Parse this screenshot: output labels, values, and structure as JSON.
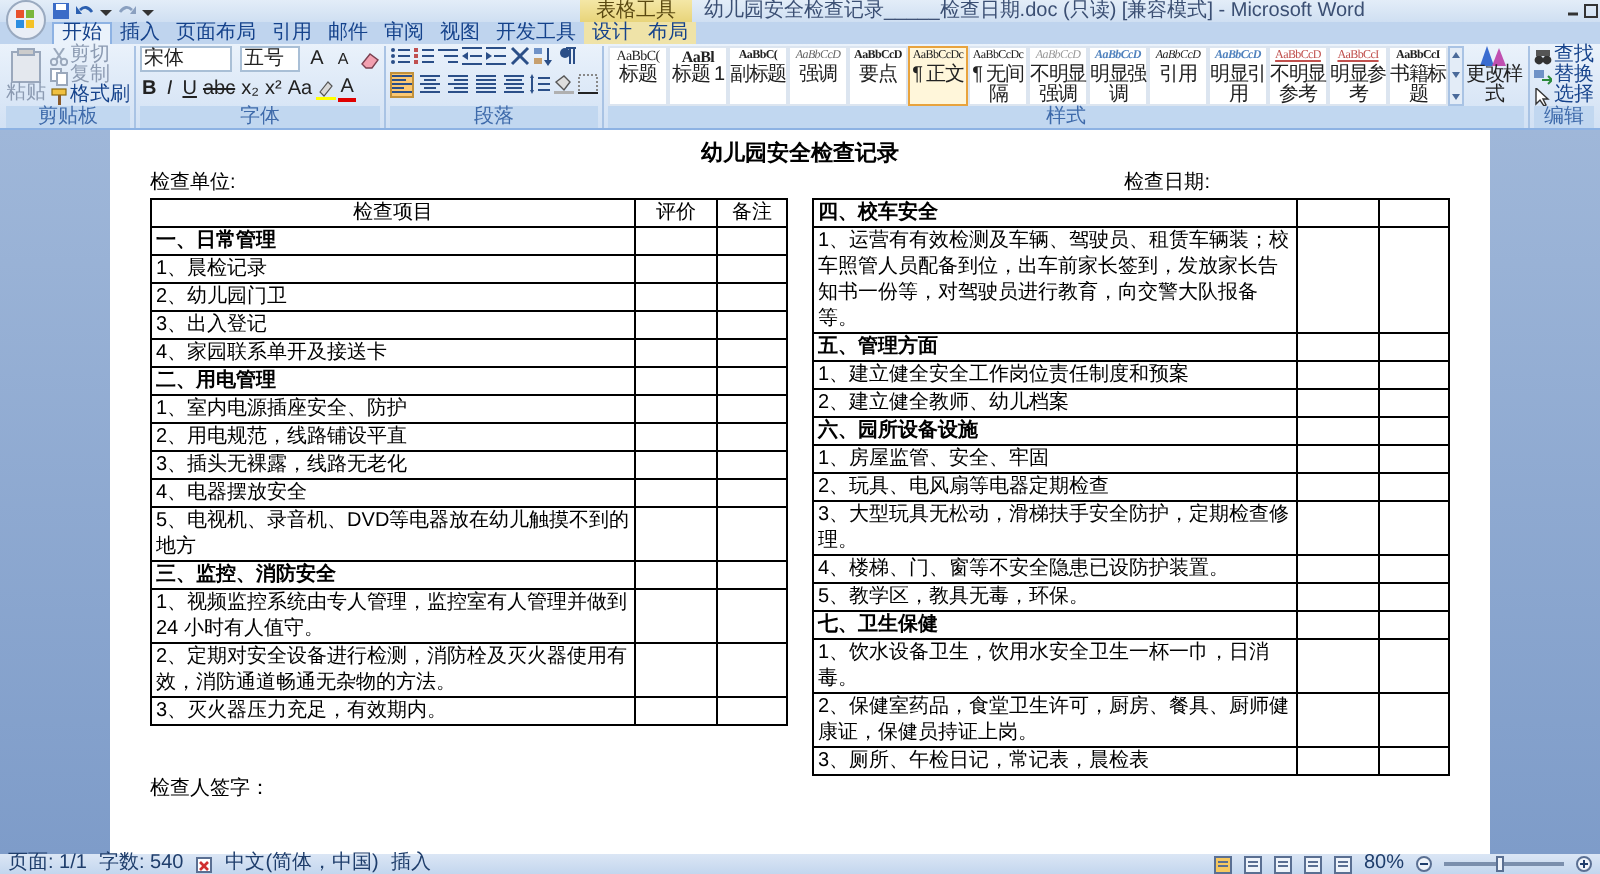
{
  "title_bar": {
    "contextual_tab": "表格工具",
    "title": "幼儿园安全检查记录_____检查日期.doc (只读) [兼容模式] - Microsoft Word"
  },
  "tabs": [
    {
      "label": "开始",
      "selected": true,
      "contextual": false
    },
    {
      "label": "插入",
      "selected": false,
      "contextual": false
    },
    {
      "label": "页面布局",
      "selected": false,
      "contextual": false
    },
    {
      "label": "引用",
      "selected": false,
      "contextual": false
    },
    {
      "label": "邮件",
      "selected": false,
      "contextual": false
    },
    {
      "label": "审阅",
      "selected": false,
      "contextual": false
    },
    {
      "label": "视图",
      "selected": false,
      "contextual": false
    },
    {
      "label": "开发工具",
      "selected": false,
      "contextual": false
    },
    {
      "label": "设计",
      "selected": false,
      "contextual": true
    },
    {
      "label": "布局",
      "selected": false,
      "contextual": true
    }
  ],
  "ribbon": {
    "clipboard": {
      "label": "剪贴板",
      "paste": {
        "label": "粘贴",
        "disabled": true
      },
      "items": [
        {
          "label": "剪切",
          "kind": "cut",
          "disabled": true
        },
        {
          "label": "复制",
          "kind": "copy",
          "disabled": true
        },
        {
          "label": "格式刷",
          "kind": "brush",
          "disabled": false
        }
      ]
    },
    "font": {
      "label": "字体",
      "font_name": "宋体",
      "font_size": "五号",
      "top_buttons": [
        {
          "label": "A",
          "kind": "grow"
        },
        {
          "label": "A",
          "kind": "shrink"
        }
      ],
      "bottom_buttons": [
        {
          "label": "B",
          "kind": "bold"
        },
        {
          "label": "I",
          "kind": "italic"
        },
        {
          "label": "U",
          "kind": "underline"
        },
        {
          "label": "abc",
          "kind": "strike"
        },
        {
          "label": "x₂",
          "kind": "plain"
        },
        {
          "label": "x²",
          "kind": "plain"
        },
        {
          "label": "Aa",
          "kind": "plain"
        },
        {
          "label": "A",
          "kind": "color"
        }
      ]
    },
    "paragraph": {
      "label": "段落",
      "alignment": [
        {
          "selected": true
        },
        {
          "selected": false
        },
        {
          "selected": false
        },
        {
          "selected": false
        },
        {
          "selected": false
        }
      ]
    },
    "styles": {
      "label": "样式",
      "change_styles": "更改样式",
      "items": [
        {
          "preview": "AaBbC(",
          "name": "标题",
          "kind": "title",
          "selected": false
        },
        {
          "preview": "AaBl",
          "name": "标题 1",
          "kind": "heading",
          "selected": false
        },
        {
          "preview": "AaBbC(",
          "name": "副标题",
          "kind": "subtitle",
          "selected": false
        },
        {
          "preview": "AaBbCcD",
          "name": "强调",
          "kind": "emphasis",
          "selected": false
        },
        {
          "preview": "AaBbCcD",
          "name": "要点",
          "kind": "strong",
          "selected": false
        },
        {
          "preview": "AaBbCcDc",
          "name": "¶ 正文",
          "kind": "normal",
          "selected": true
        },
        {
          "preview": "AaBbCcDc",
          "name": "¶ 无间隔",
          "kind": "normal",
          "selected": false
        },
        {
          "preview": "AaBbCcD",
          "name": "不明显强调",
          "kind": "subtle",
          "selected": false
        },
        {
          "preview": "AaBbCcD",
          "name": "明显强调",
          "kind": "intense",
          "selected": false
        },
        {
          "preview": "AaBbCcD",
          "name": "引用",
          "kind": "quote",
          "selected": false
        },
        {
          "preview": "AaBbCcD",
          "name": "明显引用",
          "kind": "intense",
          "selected": false
        },
        {
          "preview": "AaBbCcD",
          "name": "不明显参考",
          "kind": "reference",
          "selected": false
        },
        {
          "preview": "AaBbCcI",
          "name": "明显参考",
          "kind": "reference",
          "selected": false
        },
        {
          "preview": "AaBbCcI",
          "name": "书籍标题",
          "kind": "strong",
          "selected": false
        }
      ]
    },
    "editing": {
      "label": "编辑",
      "items": [
        {
          "label": "查找",
          "kind": "find"
        },
        {
          "label": "替换",
          "kind": "replace"
        },
        {
          "label": "选择",
          "kind": "select"
        }
      ]
    }
  },
  "document": {
    "title": "幼儿园安全检查记录",
    "unit_label": "检查单位:",
    "date_label": "检查日期:",
    "columns": [
      "检查项目",
      "评价",
      "备注"
    ],
    "rows": [
      {
        "text": "一、日常管理",
        "kind": "section"
      },
      {
        "text": "1、晨检记录",
        "kind": "item"
      },
      {
        "text": "2、幼儿园门卫",
        "kind": "item"
      },
      {
        "text": "3、出入登记",
        "kind": "item"
      },
      {
        "text": "4、家园联系单开及接送卡",
        "kind": "item"
      },
      {
        "text": "二、用电管理",
        "kind": "section"
      },
      {
        "text": "1、室内电源插座安全、防护",
        "kind": "item"
      },
      {
        "text": "2、用电规范，线路铺设平直",
        "kind": "item"
      },
      {
        "text": "3、插头无裸露，线路无老化",
        "kind": "item"
      },
      {
        "text": "4、电器摆放安全",
        "kind": "item"
      },
      {
        "text": "5、电视机、录音机、DVD等电器放在幼儿触摸不到的地方",
        "kind": "item"
      },
      {
        "text": "三、监控、消防安全",
        "kind": "section"
      },
      {
        "text": "1、视频监控系统由专人管理，监控室有人管理并做到 24 小时有人值守。",
        "kind": "item"
      },
      {
        "text": "2、定期对安全设备进行检测，消防栓及灭火器使用有效，消防通道畅通无杂物的方法。",
        "kind": "item"
      },
      {
        "text": "3、灭火器压力充足，有效期内。",
        "kind": "item"
      },
      {
        "text": "四、校车安全",
        "kind": "section"
      },
      {
        "text": "1、运营有有效检测及车辆、驾驶员、租赁车辆装；校车照管人员配备到位，出车前家长签到，发放家长告知书一份等，对驾驶员进行教育，向交警大队报备等。",
        "kind": "item"
      },
      {
        "text": "五、管理方面",
        "kind": "section"
      },
      {
        "text": "1、建立健全安全工作岗位责任制度和预案",
        "kind": "item"
      },
      {
        "text": "2、建立健全教师、幼儿档案",
        "kind": "item"
      },
      {
        "text": "六、园所设备设施",
        "kind": "section"
      },
      {
        "text": "1、房屋监管、安全、牢固",
        "kind": "item"
      },
      {
        "text": "2、玩具、电风扇等电器定期检查",
        "kind": "item"
      },
      {
        "text": "3、大型玩具无松动，滑梯扶手安全防护，定期检查修理。",
        "kind": "item"
      },
      {
        "text": "4、楼梯、门、窗等不安全隐患已设防护装置。",
        "kind": "item"
      },
      {
        "text": "5、教学区，教具无毒，环保。",
        "kind": "item"
      },
      {
        "text": "七、卫生保健",
        "kind": "section"
      },
      {
        "text": "1、饮水设备卫生，饮用水安全卫生一杯一巾，日消毒。",
        "kind": "item"
      },
      {
        "text": "2、保健室药品，食堂卫生许可，厨房、餐具、厨师健康证，保健员持证上岗。",
        "kind": "item"
      },
      {
        "text": "3、厕所、午检日记，常记表，晨检表",
        "kind": "item"
      }
    ],
    "signature": "检查人签字："
  },
  "status_bar": {
    "page": "页面: 1/1",
    "words": "字数: 540",
    "language": "中文(简体，中国)",
    "mode": "插入",
    "zoom": "80%",
    "zoom_slider": {
      "level": 0.46
    }
  }
}
